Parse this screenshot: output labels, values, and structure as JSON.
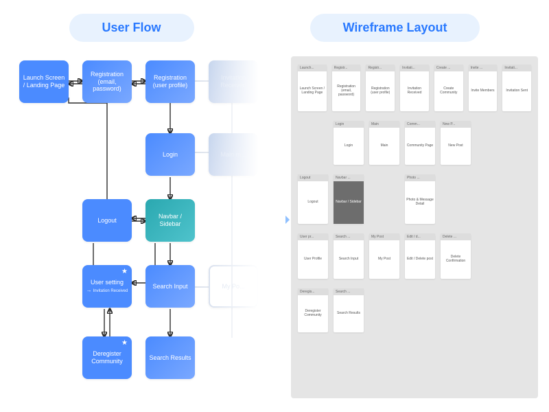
{
  "headers": {
    "flow": "User Flow",
    "wire": "Wireframe Layout"
  },
  "flow_nodes": {
    "launch": "Launch Screen / Landing Page",
    "reg_cred": "Registration (email, password)",
    "reg_prof": "Registration (user profile)",
    "inv_recv": "Invitation Received",
    "login": "Login",
    "main": "Main m...",
    "logout": "Logout",
    "navbar": "Navbar / Sidebar",
    "user_set": "User setting",
    "user_set_sub": "Invitation Received",
    "search_in": "Search Input",
    "my_post": "My Po...",
    "dereg": "Deregister Community",
    "search_rs": "Search Results"
  },
  "wire_rows": [
    [
      {
        "tab": "Launch...",
        "body": "Launch Screen / Landing Page"
      },
      {
        "tab": "Registr...",
        "body": "Registration (email, password)"
      },
      {
        "tab": "Registr...",
        "body": "Registration (user profile)"
      },
      {
        "tab": "Invitati...",
        "body": "Invitation Received"
      },
      {
        "tab": "Create ...",
        "body": "Create Community"
      },
      {
        "tab": "Invite ...",
        "body": "Invite Members"
      },
      {
        "tab": "Invitati...",
        "body": "Invitation Sent"
      }
    ],
    [
      {
        "tab": "Login",
        "body": "Login"
      },
      {
        "tab": "Main",
        "body": "Main"
      },
      {
        "tab": "Comm...",
        "body": "Community Page"
      },
      {
        "tab": "New P...",
        "body": "New Post"
      }
    ],
    [
      {
        "tab": "Logout",
        "body": "Logout"
      },
      {
        "tab": "Navbar ...",
        "body": "Navbar / Sidebar",
        "dark": true
      },
      {
        "gap": true
      },
      {
        "tab": "Photo ...",
        "body": "Photo & Message Detail"
      }
    ],
    [
      {
        "tab": "User pr...",
        "body": "User Profile"
      },
      {
        "tab": "Search ...",
        "body": "Search Input"
      },
      {
        "tab": "My Post",
        "body": "My Post"
      },
      {
        "tab": "Edit / d...",
        "body": "Edit / Delete post"
      },
      {
        "tab": "Delete ...",
        "body": "Delete Confirmation"
      }
    ],
    [
      {
        "tab": "Deregis...",
        "body": "Deregister Community"
      },
      {
        "tab": "Search ...",
        "body": "Search Results"
      }
    ]
  ]
}
